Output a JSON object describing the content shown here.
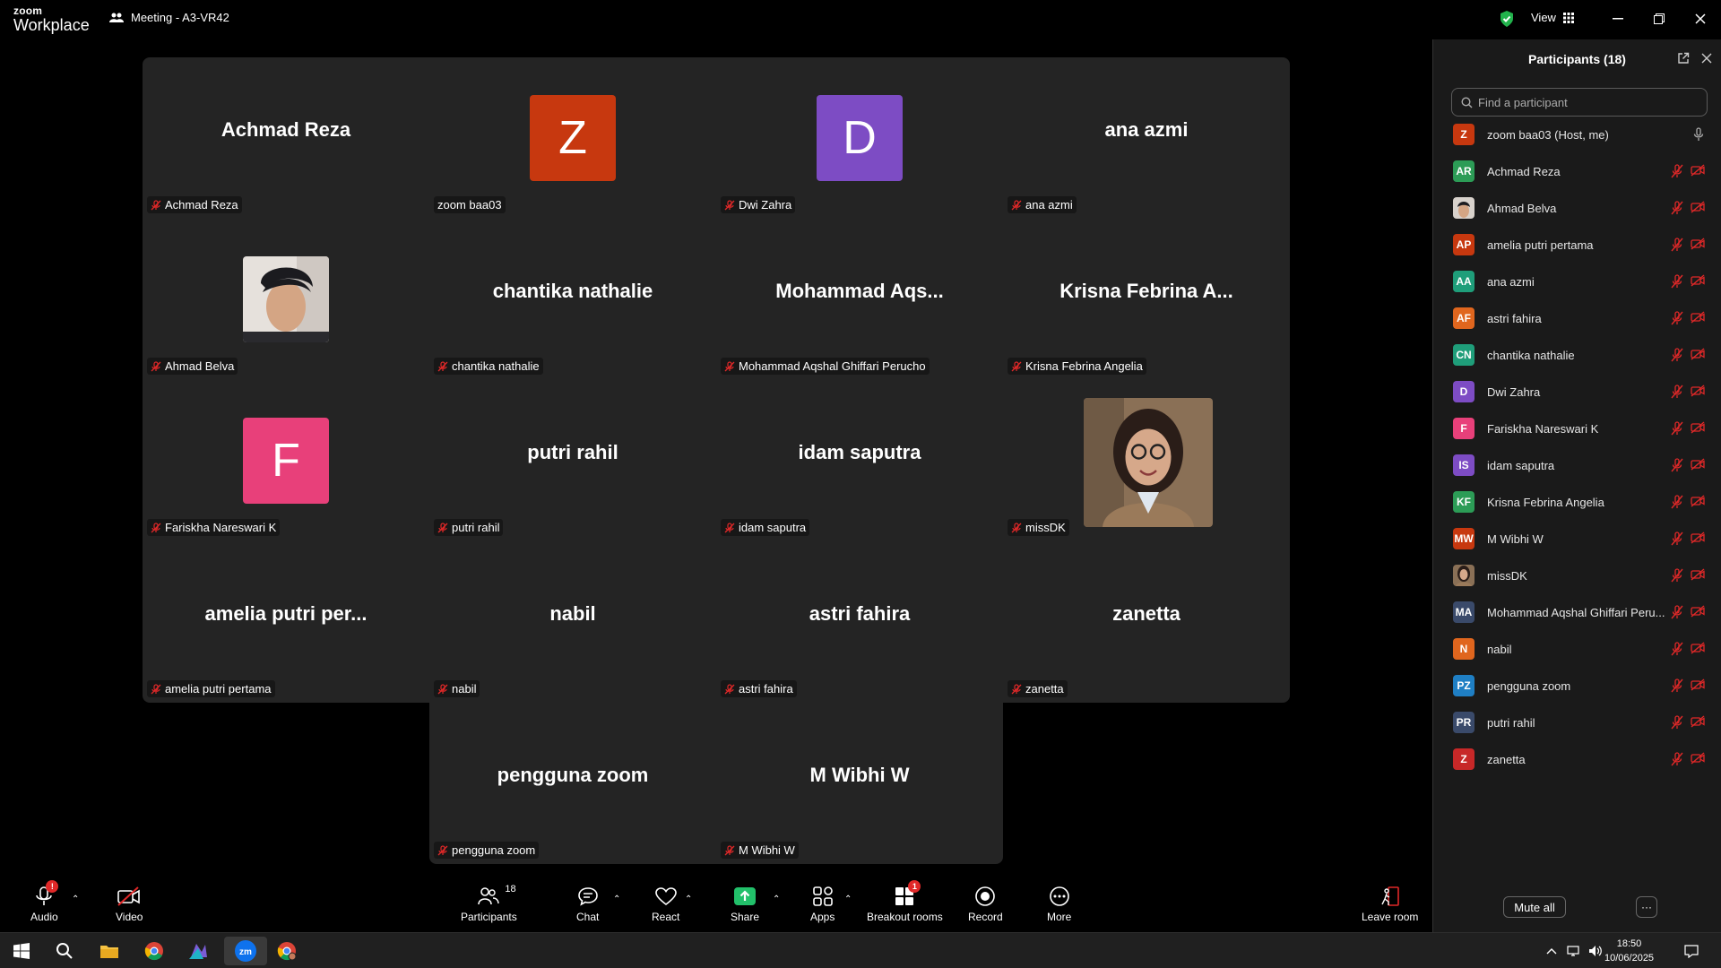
{
  "titlebar": {
    "logo_line1": "zoom",
    "logo_line2": "Workplace",
    "meeting_title": "Meeting - A3-VR42",
    "view_label": "View"
  },
  "tiles": [
    {
      "big": "Achmad Reza",
      "name": "Achmad Reza",
      "avatar": null
    },
    {
      "big": "",
      "name": "zoom baa03",
      "avatar": "Z",
      "color": "#c7380f",
      "unmuted": true
    },
    {
      "big": "",
      "name": "Dwi Zahra",
      "avatar": "D",
      "color": "#7d4cc4"
    },
    {
      "big": "ana azmi",
      "name": "ana azmi",
      "avatar": null
    },
    {
      "big": "",
      "name": "Ahmad Belva",
      "avatar": "photo-boy"
    },
    {
      "big": "chantika nathalie",
      "name": "chantika nathalie",
      "avatar": null
    },
    {
      "big": "Mohammad  Aqs...",
      "name": "Mohammad Aqshal Ghiffari Perucho",
      "avatar": null
    },
    {
      "big": "Krisna  Febrina  A...",
      "name": "Krisna Febrina Angelia",
      "avatar": null
    },
    {
      "big": "",
      "name": "Fariskha Nareswari K",
      "avatar": "F",
      "color": "#e8407a"
    },
    {
      "big": "putri rahil",
      "name": "putri rahil",
      "avatar": null
    },
    {
      "big": "idam saputra",
      "name": "idam saputra",
      "avatar": null
    },
    {
      "big": "",
      "name": "missDK",
      "avatar": "photo-woman"
    },
    {
      "big": "amelia  putri  per...",
      "name": "amelia putri pertama",
      "avatar": null
    },
    {
      "big": "nabil",
      "name": "nabil",
      "avatar": null
    },
    {
      "big": "astri fahira",
      "name": "astri fahira",
      "avatar": null
    },
    {
      "big": "zanetta",
      "name": "zanetta",
      "avatar": null
    },
    {
      "big": "pengguna zoom",
      "name": "pengguna zoom",
      "avatar": null
    },
    {
      "big": "M Wibhi W",
      "name": "M Wibhi W",
      "avatar": null
    }
  ],
  "panel": {
    "title": "Participants (18)",
    "search_placeholder": "Find a participant",
    "mute_all": "Mute all",
    "more": "···",
    "participants": [
      {
        "initials": "Z",
        "name": "zoom baa03 (Host, me)",
        "color": "#c7380f",
        "host": true
      },
      {
        "initials": "AR",
        "name": "Achmad Reza",
        "color": "#2c9c56"
      },
      {
        "initials": "",
        "name": "Ahmad Belva",
        "color": "#555",
        "photo": "boy"
      },
      {
        "initials": "AP",
        "name": "amelia putri pertama",
        "color": "#c7380f"
      },
      {
        "initials": "AA",
        "name": "ana azmi",
        "color": "#1f9e7a"
      },
      {
        "initials": "AF",
        "name": "astri fahira",
        "color": "#e0661e"
      },
      {
        "initials": "CN",
        "name": "chantika nathalie",
        "color": "#1f9e7a"
      },
      {
        "initials": "D",
        "name": "Dwi Zahra",
        "color": "#7d4cc4"
      },
      {
        "initials": "F",
        "name": "Fariskha Nareswari K",
        "color": "#e8407a"
      },
      {
        "initials": "IS",
        "name": "idam saputra",
        "color": "#7d4cc4"
      },
      {
        "initials": "KF",
        "name": "Krisna Febrina Angelia",
        "color": "#2c9c56"
      },
      {
        "initials": "MW",
        "name": "M Wibhi W",
        "color": "#c7380f"
      },
      {
        "initials": "",
        "name": "missDK",
        "color": "#8a6a4a",
        "photo": "woman"
      },
      {
        "initials": "MA",
        "name": "Mohammad Aqshal Ghiffari Peru...",
        "color": "#3a4a6a"
      },
      {
        "initials": "N",
        "name": "nabil",
        "color": "#e0661e"
      },
      {
        "initials": "PZ",
        "name": "pengguna zoom",
        "color": "#1f7fc4"
      },
      {
        "initials": "PR",
        "name": "putri rahil",
        "color": "#3a4a6a"
      },
      {
        "initials": "Z",
        "name": "zanetta",
        "color": "#c72828"
      }
    ]
  },
  "toolbar": {
    "audio": "Audio",
    "video": "Video",
    "participants": "Participants",
    "participants_count": "18",
    "chat": "Chat",
    "react": "React",
    "share": "Share",
    "apps": "Apps",
    "breakout": "Breakout rooms",
    "breakout_badge": "1",
    "audio_badge": "!",
    "record": "Record",
    "more": "More",
    "leave": "Leave room"
  },
  "taskbar": {
    "time": "18:50",
    "date": "10/06/2025"
  },
  "colors": {
    "tile_bg": "#242424",
    "share_green": "#22c06a",
    "mute_red": "#e02828",
    "accent_blue": "#0e72ed"
  }
}
